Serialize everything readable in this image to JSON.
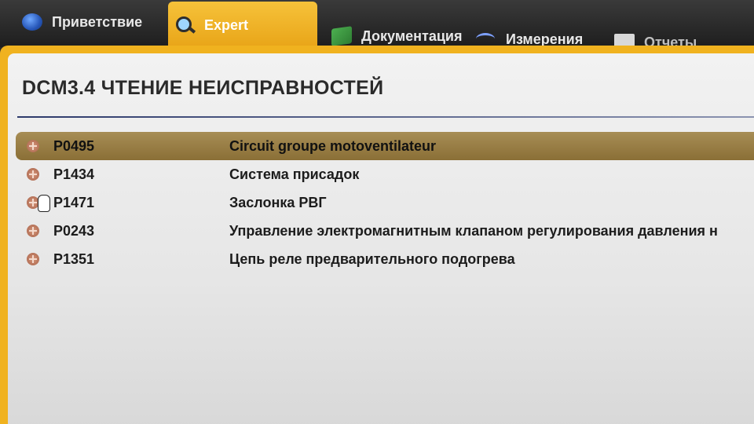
{
  "tabs": [
    {
      "label": "Приветствие",
      "icon": "globe-icon"
    },
    {
      "label": "Expert",
      "icon": "magnifier-icon",
      "active": true
    },
    {
      "label": "Документация",
      "icon": "book-icon"
    },
    {
      "label": "Измерения",
      "icon": "waveform-icon"
    },
    {
      "label": "Отчеты",
      "icon": "report-icon"
    }
  ],
  "page": {
    "title": "DCM3.4  ЧТЕНИЕ НЕИСПРАВНОСТЕЙ"
  },
  "faults": [
    {
      "code": "P0495",
      "description": "Circuit groupe motoventilateur",
      "selected": true
    },
    {
      "code": "P1434",
      "description": "Система присадок"
    },
    {
      "code": "P1471",
      "description": "Заслонка РВГ"
    },
    {
      "code": "P0243",
      "description": "Управление электромагнитным клапаном регулирования давления н"
    },
    {
      "code": "P1351",
      "description": "Цепь реле предварительного подогрева"
    }
  ],
  "colors": {
    "accent": "#f0b21f",
    "selected_row": "#9c7f45",
    "title_rule": "#2d3a6b"
  }
}
